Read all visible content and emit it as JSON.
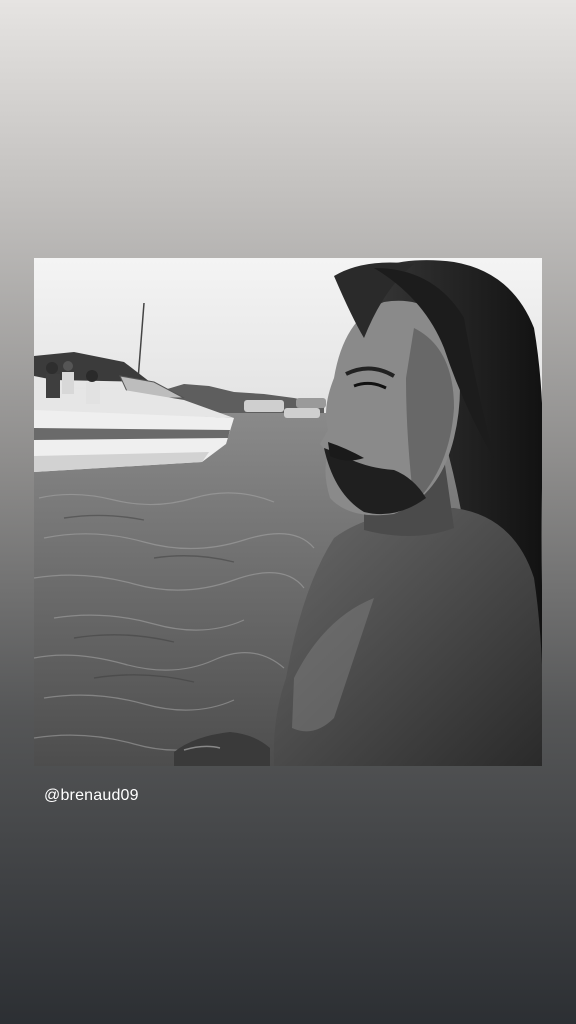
{
  "story": {
    "background_top": "#e6e4e2",
    "background_bottom": "#2c2f33",
    "photo": {
      "alt": "",
      "filter": "black-and-white"
    },
    "mention": {
      "text": "@brenaud09"
    }
  }
}
